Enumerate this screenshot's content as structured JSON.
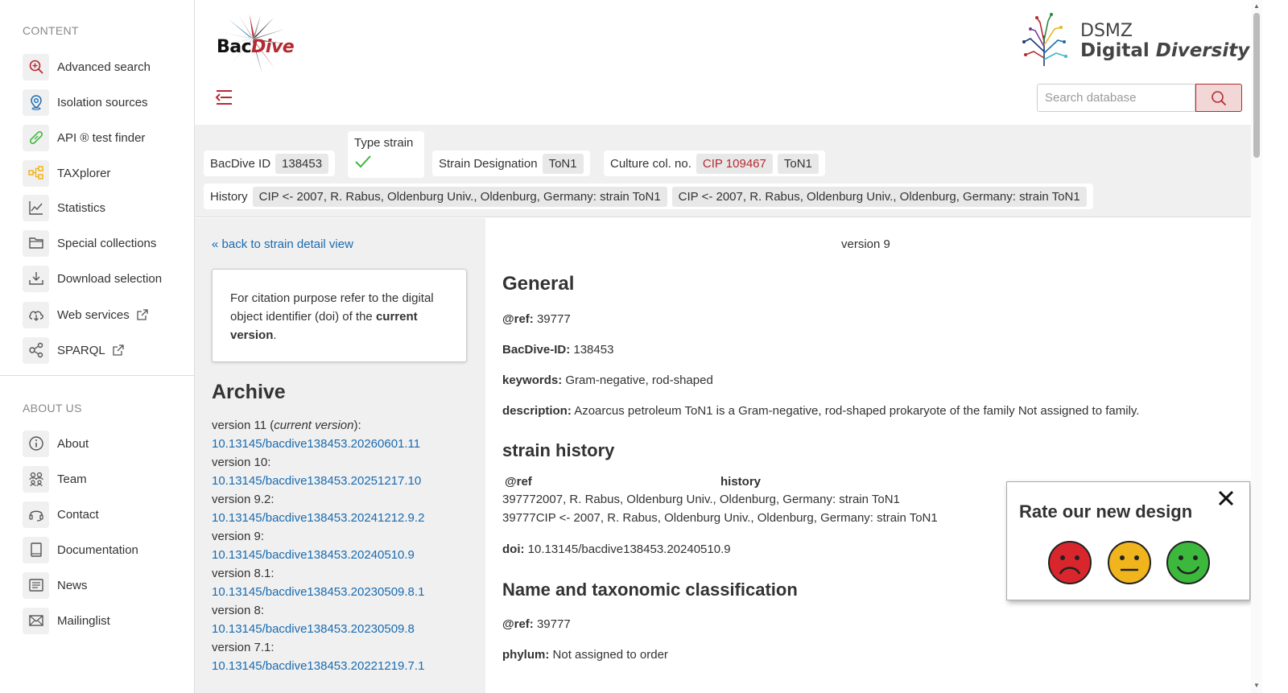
{
  "sidebar": {
    "content_title": "CONTENT",
    "about_title": "ABOUT US",
    "content_items": [
      {
        "label": "Advanced search",
        "icon": "zoom-in-icon"
      },
      {
        "label": "Isolation sources",
        "icon": "map-pin-icon"
      },
      {
        "label": "API ® test finder",
        "icon": "test-tube-icon"
      },
      {
        "label": "TAXplorer",
        "icon": "tree-structure-icon"
      },
      {
        "label": "Statistics",
        "icon": "line-chart-icon"
      },
      {
        "label": "Special collections",
        "icon": "folder-icon"
      },
      {
        "label": "Download selection",
        "icon": "download-icon"
      },
      {
        "label": "Web services",
        "icon": "cloud-download-icon"
      },
      {
        "label": "SPARQL",
        "icon": "share-nodes-icon"
      }
    ],
    "about_items": [
      {
        "label": "About",
        "icon": "info-icon"
      },
      {
        "label": "Team",
        "icon": "team-icon"
      },
      {
        "label": "Contact",
        "icon": "headset-icon"
      },
      {
        "label": "Documentation",
        "icon": "book-icon"
      },
      {
        "label": "News",
        "icon": "newspaper-icon"
      },
      {
        "label": "Mailinglist",
        "icon": "mail-icon"
      }
    ]
  },
  "header": {
    "logo_bac": "Bac",
    "logo_dive": "Dive",
    "dsmz_top": "DSMZ",
    "dsmz_bottom_1": "Digital ",
    "dsmz_bottom_2": "Diversity",
    "search_placeholder": "Search database"
  },
  "infobar": {
    "bacdive_id_label": "BacDive ID",
    "bacdive_id": "138453",
    "type_strain_label": "Type strain",
    "strain_designation_label": "Strain Designation",
    "strain_designation": "ToN1",
    "culture_label": "Culture col. no.",
    "culture_cip": "CIP 109467",
    "culture_ton1": "ToN1",
    "history_label": "History",
    "history_1": "CIP <- 2007, R. Rabus, Oldenburg Univ., Oldenburg, Germany: strain ToN1",
    "history_2": "CIP <- 2007, R. Rabus, Oldenburg Univ., Oldenburg, Germany: strain ToN1"
  },
  "archive": {
    "back_link": "« back to strain detail view",
    "cite_1": "For citation purpose refer to the digital object identifier (doi) of the ",
    "cite_bold": "current version",
    "cite_end": ".",
    "title": "Archive",
    "current_prefix": "version 11 (",
    "current_italic": "current version",
    "current_suffix": "):",
    "versions": [
      {
        "label": "version 10:",
        "doi": "10.13145/bacdive138453.20251217.10"
      },
      {
        "label": "version 9.2:",
        "doi": "10.13145/bacdive138453.20241212.9.2"
      },
      {
        "label": "version 9:",
        "doi": "10.13145/bacdive138453.20240510.9"
      },
      {
        "label": "version 8.1:",
        "doi": "10.13145/bacdive138453.20230509.8.1"
      },
      {
        "label": "version 8:",
        "doi": "10.13145/bacdive138453.20230509.8"
      },
      {
        "label": "version 7.1:",
        "doi": "10.13145/bacdive138453.20221219.7.1"
      }
    ],
    "current_doi": "10.13145/bacdive138453.20260601.11"
  },
  "main": {
    "version_label": "version 9",
    "general_title": "General",
    "ref_label": "@ref:",
    "ref_value": "39777",
    "bacdive_id_label": "BacDive-ID:",
    "bacdive_id_value": "138453",
    "keywords_label": "keywords:",
    "keywords_value": "Gram-negative, rod-shaped",
    "description_label": "description:",
    "description_value": "Azoarcus petroleum ToN1 is a Gram-negative, rod-shaped prokaryote of the family Not assigned to family.",
    "strain_history_title": "strain history",
    "hist_col_ref": "@ref",
    "hist_col_history": "history",
    "hist_rows": [
      "397772007, R. Rabus, Oldenburg Univ., Oldenburg, Germany: strain ToN1",
      "39777CIP <- 2007, R. Rabus, Oldenburg Univ., Oldenburg, Germany: strain ToN1"
    ],
    "doi_label": "doi:",
    "doi_value": "10.13145/bacdive138453.20240510.9",
    "taxo_title": "Name and taxonomic classification",
    "taxo_ref_label": "@ref:",
    "taxo_ref_value": "39777",
    "phylum_label": "phylum:",
    "phylum_value": "Not assigned to order"
  },
  "rating": {
    "title": "Rate our new design",
    "colors": {
      "sad": "#d9262c",
      "neutral": "#f0b41c",
      "happy": "#3cb83c"
    }
  },
  "colors": {
    "accent": "#b52a32",
    "link": "#1a6bb0"
  }
}
